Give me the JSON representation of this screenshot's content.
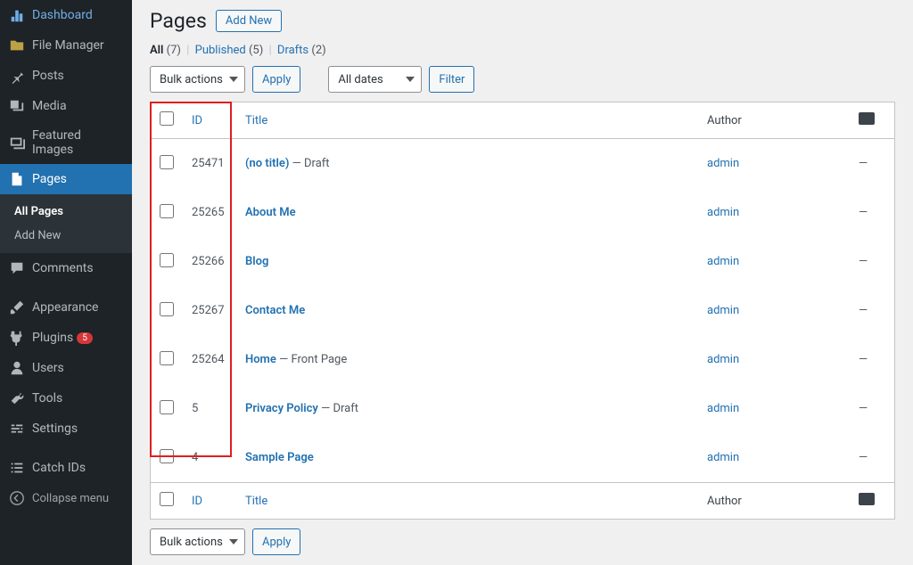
{
  "sidebar": {
    "items": [
      {
        "name": "dashboard",
        "label": "Dashboard",
        "icon": "dashboard"
      },
      {
        "name": "file-manager",
        "label": "File Manager",
        "icon": "folder"
      },
      {
        "name": "posts",
        "label": "Posts",
        "icon": "pin"
      },
      {
        "name": "media",
        "label": "Media",
        "icon": "media"
      },
      {
        "name": "featured-images",
        "label": "Featured Images",
        "icon": "images"
      },
      {
        "name": "pages",
        "label": "Pages",
        "icon": "page",
        "current": true
      },
      {
        "name": "comments",
        "label": "Comments",
        "icon": "comment"
      },
      {
        "name": "appearance",
        "label": "Appearance",
        "icon": "brush"
      },
      {
        "name": "plugins",
        "label": "Plugins",
        "icon": "plug",
        "badge": "5"
      },
      {
        "name": "users",
        "label": "Users",
        "icon": "user"
      },
      {
        "name": "tools",
        "label": "Tools",
        "icon": "wrench"
      },
      {
        "name": "settings",
        "label": "Settings",
        "icon": "sliders"
      },
      {
        "name": "catch-ids",
        "label": "Catch IDs",
        "icon": "list"
      }
    ],
    "submenu": [
      {
        "label": "All Pages",
        "current": true
      },
      {
        "label": "Add New"
      }
    ],
    "collapse_label": "Collapse menu"
  },
  "header": {
    "title": "Pages",
    "add_new": "Add New"
  },
  "views": {
    "all_label": "All",
    "all_count": "(7)",
    "published_label": "Published",
    "published_count": "(5)",
    "drafts_label": "Drafts",
    "drafts_count": "(2)"
  },
  "actions": {
    "bulk_placeholder": "Bulk actions",
    "apply": "Apply",
    "dates_placeholder": "All dates",
    "filter": "Filter"
  },
  "table": {
    "col_id": "ID",
    "col_title": "Title",
    "col_author": "Author",
    "rows": [
      {
        "id": "25471",
        "title": "(no title)",
        "suffix": " — Draft",
        "author": "admin",
        "comments": "—"
      },
      {
        "id": "25265",
        "title": "About Me",
        "suffix": "",
        "author": "admin",
        "comments": "—"
      },
      {
        "id": "25266",
        "title": "Blog",
        "suffix": "",
        "author": "admin",
        "comments": "—"
      },
      {
        "id": "25267",
        "title": "Contact Me",
        "suffix": "",
        "author": "admin",
        "comments": "—"
      },
      {
        "id": "25264",
        "title": "Home",
        "suffix": " — Front Page",
        "author": "admin",
        "comments": "—"
      },
      {
        "id": "5",
        "title": "Privacy Policy",
        "suffix": " — Draft",
        "author": "admin",
        "comments": "—"
      },
      {
        "id": "4",
        "title": "Sample Page",
        "suffix": "",
        "author": "admin",
        "comments": "—"
      }
    ]
  }
}
